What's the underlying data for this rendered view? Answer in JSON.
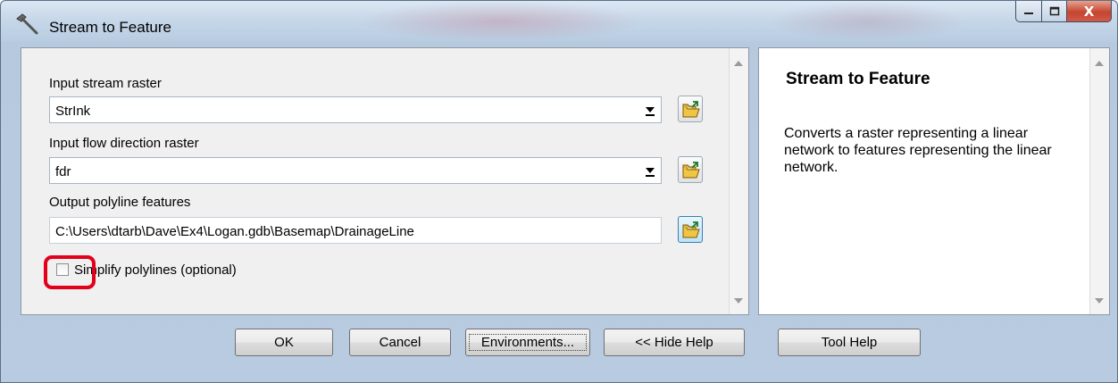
{
  "window": {
    "title": "Stream to Feature",
    "icon": "hammer-icon",
    "controls": {
      "minimize": "minimize-icon",
      "maximize": "maximize-icon",
      "close": "X"
    }
  },
  "form": {
    "input_stream_raster": {
      "label": "Input stream raster",
      "value": "StrInk"
    },
    "input_flow_direction_raster": {
      "label": "Input flow direction raster",
      "value": "fdr"
    },
    "output_polyline_features": {
      "label": "Output polyline features",
      "value": "C:\\Users\\dtarb\\Dave\\Ex4\\Logan.gdb\\Basemap\\DrainageLine"
    },
    "simplify_polylines": {
      "label": "Simplify polylines (optional)",
      "checked": false
    }
  },
  "help": {
    "title": "Stream to Feature",
    "body": "Converts a raster representing a linear network to features representing the linear network."
  },
  "buttons": {
    "ok": "OK",
    "cancel": "Cancel",
    "environments": "Environments...",
    "hide_help": "<< Hide Help",
    "tool_help": "Tool Help"
  },
  "colors": {
    "highlight": "#e2001a",
    "frame": "#b9cbe0"
  }
}
